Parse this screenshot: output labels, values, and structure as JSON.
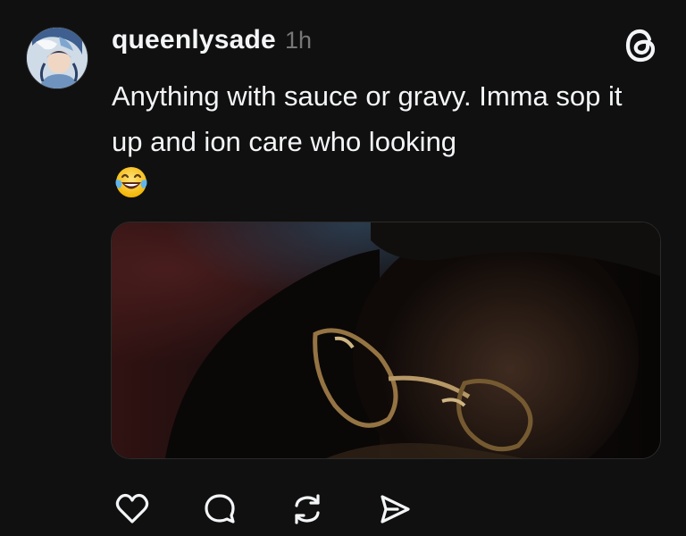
{
  "post": {
    "username": "queenlysade",
    "timestamp": "1h",
    "text": "Anything with sauce or gravy. Imma sop it up and ion care who looking",
    "emoji": "tears-of-joy-emoji",
    "avatar_icon": "avatar-illustration",
    "app_icon": "threads-logo-icon"
  },
  "media": {
    "type": "video-still"
  },
  "actions": [
    {
      "name": "like",
      "icon": "heart-icon"
    },
    {
      "name": "reply",
      "icon": "comment-icon"
    },
    {
      "name": "repost",
      "icon": "repost-icon"
    },
    {
      "name": "share",
      "icon": "send-icon"
    }
  ],
  "colors": {
    "background": "#101010",
    "text": "#f3f5f7",
    "secondary_text": "#777777"
  }
}
